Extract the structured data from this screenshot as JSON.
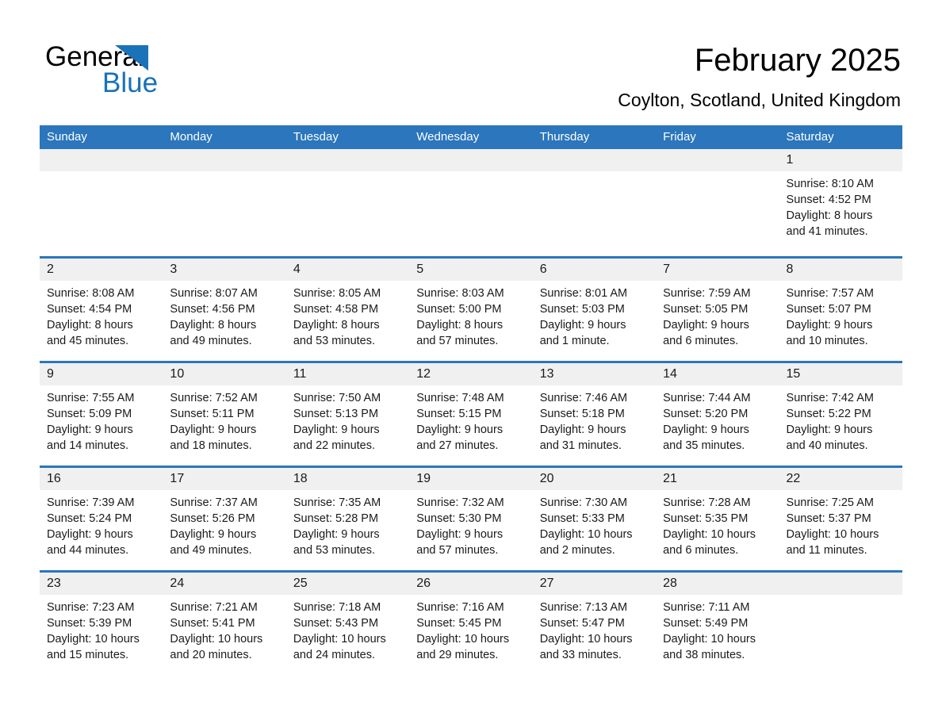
{
  "brand": {
    "name_part1": "General",
    "name_part2": "Blue",
    "triangle_color": "#1a72b8"
  },
  "header": {
    "month_title": "February 2025",
    "location": "Coylton, Scotland, United Kingdom"
  },
  "theme": {
    "header_blue": "#2b76bc",
    "day_band_gray": "#f0f0f0",
    "text_color": "#1a1a1a"
  },
  "calendar": {
    "weekdays": [
      "Sunday",
      "Monday",
      "Tuesday",
      "Wednesday",
      "Thursday",
      "Friday",
      "Saturday"
    ],
    "weeks": [
      [
        {
          "day": "",
          "sunrise": "",
          "sunset": "",
          "daylight1": "",
          "daylight2": ""
        },
        {
          "day": "",
          "sunrise": "",
          "sunset": "",
          "daylight1": "",
          "daylight2": ""
        },
        {
          "day": "",
          "sunrise": "",
          "sunset": "",
          "daylight1": "",
          "daylight2": ""
        },
        {
          "day": "",
          "sunrise": "",
          "sunset": "",
          "daylight1": "",
          "daylight2": ""
        },
        {
          "day": "",
          "sunrise": "",
          "sunset": "",
          "daylight1": "",
          "daylight2": ""
        },
        {
          "day": "",
          "sunrise": "",
          "sunset": "",
          "daylight1": "",
          "daylight2": ""
        },
        {
          "day": "1",
          "sunrise": "Sunrise: 8:10 AM",
          "sunset": "Sunset: 4:52 PM",
          "daylight1": "Daylight: 8 hours",
          "daylight2": "and 41 minutes."
        }
      ],
      [
        {
          "day": "2",
          "sunrise": "Sunrise: 8:08 AM",
          "sunset": "Sunset: 4:54 PM",
          "daylight1": "Daylight: 8 hours",
          "daylight2": "and 45 minutes."
        },
        {
          "day": "3",
          "sunrise": "Sunrise: 8:07 AM",
          "sunset": "Sunset: 4:56 PM",
          "daylight1": "Daylight: 8 hours",
          "daylight2": "and 49 minutes."
        },
        {
          "day": "4",
          "sunrise": "Sunrise: 8:05 AM",
          "sunset": "Sunset: 4:58 PM",
          "daylight1": "Daylight: 8 hours",
          "daylight2": "and 53 minutes."
        },
        {
          "day": "5",
          "sunrise": "Sunrise: 8:03 AM",
          "sunset": "Sunset: 5:00 PM",
          "daylight1": "Daylight: 8 hours",
          "daylight2": "and 57 minutes."
        },
        {
          "day": "6",
          "sunrise": "Sunrise: 8:01 AM",
          "sunset": "Sunset: 5:03 PM",
          "daylight1": "Daylight: 9 hours",
          "daylight2": "and 1 minute."
        },
        {
          "day": "7",
          "sunrise": "Sunrise: 7:59 AM",
          "sunset": "Sunset: 5:05 PM",
          "daylight1": "Daylight: 9 hours",
          "daylight2": "and 6 minutes."
        },
        {
          "day": "8",
          "sunrise": "Sunrise: 7:57 AM",
          "sunset": "Sunset: 5:07 PM",
          "daylight1": "Daylight: 9 hours",
          "daylight2": "and 10 minutes."
        }
      ],
      [
        {
          "day": "9",
          "sunrise": "Sunrise: 7:55 AM",
          "sunset": "Sunset: 5:09 PM",
          "daylight1": "Daylight: 9 hours",
          "daylight2": "and 14 minutes."
        },
        {
          "day": "10",
          "sunrise": "Sunrise: 7:52 AM",
          "sunset": "Sunset: 5:11 PM",
          "daylight1": "Daylight: 9 hours",
          "daylight2": "and 18 minutes."
        },
        {
          "day": "11",
          "sunrise": "Sunrise: 7:50 AM",
          "sunset": "Sunset: 5:13 PM",
          "daylight1": "Daylight: 9 hours",
          "daylight2": "and 22 minutes."
        },
        {
          "day": "12",
          "sunrise": "Sunrise: 7:48 AM",
          "sunset": "Sunset: 5:15 PM",
          "daylight1": "Daylight: 9 hours",
          "daylight2": "and 27 minutes."
        },
        {
          "day": "13",
          "sunrise": "Sunrise: 7:46 AM",
          "sunset": "Sunset: 5:18 PM",
          "daylight1": "Daylight: 9 hours",
          "daylight2": "and 31 minutes."
        },
        {
          "day": "14",
          "sunrise": "Sunrise: 7:44 AM",
          "sunset": "Sunset: 5:20 PM",
          "daylight1": "Daylight: 9 hours",
          "daylight2": "and 35 minutes."
        },
        {
          "day": "15",
          "sunrise": "Sunrise: 7:42 AM",
          "sunset": "Sunset: 5:22 PM",
          "daylight1": "Daylight: 9 hours",
          "daylight2": "and 40 minutes."
        }
      ],
      [
        {
          "day": "16",
          "sunrise": "Sunrise: 7:39 AM",
          "sunset": "Sunset: 5:24 PM",
          "daylight1": "Daylight: 9 hours",
          "daylight2": "and 44 minutes."
        },
        {
          "day": "17",
          "sunrise": "Sunrise: 7:37 AM",
          "sunset": "Sunset: 5:26 PM",
          "daylight1": "Daylight: 9 hours",
          "daylight2": "and 49 minutes."
        },
        {
          "day": "18",
          "sunrise": "Sunrise: 7:35 AM",
          "sunset": "Sunset: 5:28 PM",
          "daylight1": "Daylight: 9 hours",
          "daylight2": "and 53 minutes."
        },
        {
          "day": "19",
          "sunrise": "Sunrise: 7:32 AM",
          "sunset": "Sunset: 5:30 PM",
          "daylight1": "Daylight: 9 hours",
          "daylight2": "and 57 minutes."
        },
        {
          "day": "20",
          "sunrise": "Sunrise: 7:30 AM",
          "sunset": "Sunset: 5:33 PM",
          "daylight1": "Daylight: 10 hours",
          "daylight2": "and 2 minutes."
        },
        {
          "day": "21",
          "sunrise": "Sunrise: 7:28 AM",
          "sunset": "Sunset: 5:35 PM",
          "daylight1": "Daylight: 10 hours",
          "daylight2": "and 6 minutes."
        },
        {
          "day": "22",
          "sunrise": "Sunrise: 7:25 AM",
          "sunset": "Sunset: 5:37 PM",
          "daylight1": "Daylight: 10 hours",
          "daylight2": "and 11 minutes."
        }
      ],
      [
        {
          "day": "23",
          "sunrise": "Sunrise: 7:23 AM",
          "sunset": "Sunset: 5:39 PM",
          "daylight1": "Daylight: 10 hours",
          "daylight2": "and 15 minutes."
        },
        {
          "day": "24",
          "sunrise": "Sunrise: 7:21 AM",
          "sunset": "Sunset: 5:41 PM",
          "daylight1": "Daylight: 10 hours",
          "daylight2": "and 20 minutes."
        },
        {
          "day": "25",
          "sunrise": "Sunrise: 7:18 AM",
          "sunset": "Sunset: 5:43 PM",
          "daylight1": "Daylight: 10 hours",
          "daylight2": "and 24 minutes."
        },
        {
          "day": "26",
          "sunrise": "Sunrise: 7:16 AM",
          "sunset": "Sunset: 5:45 PM",
          "daylight1": "Daylight: 10 hours",
          "daylight2": "and 29 minutes."
        },
        {
          "day": "27",
          "sunrise": "Sunrise: 7:13 AM",
          "sunset": "Sunset: 5:47 PM",
          "daylight1": "Daylight: 10 hours",
          "daylight2": "and 33 minutes."
        },
        {
          "day": "28",
          "sunrise": "Sunrise: 7:11 AM",
          "sunset": "Sunset: 5:49 PM",
          "daylight1": "Daylight: 10 hours",
          "daylight2": "and 38 minutes."
        },
        {
          "day": "",
          "sunrise": "",
          "sunset": "",
          "daylight1": "",
          "daylight2": ""
        }
      ]
    ]
  }
}
